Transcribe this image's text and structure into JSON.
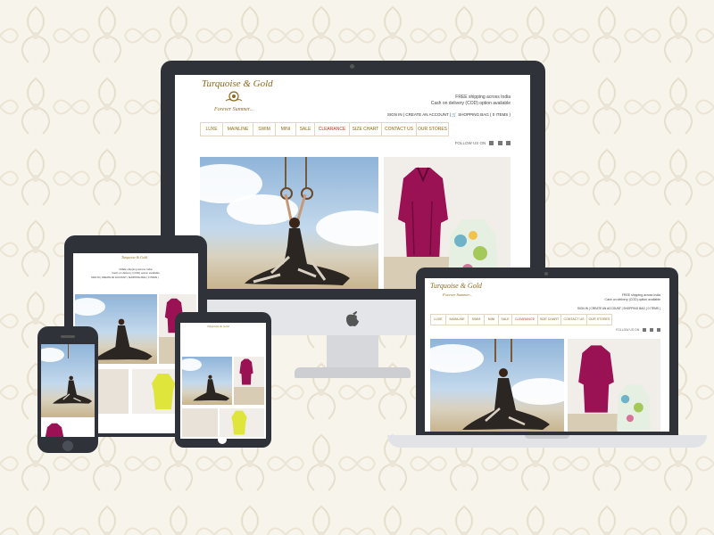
{
  "brand": {
    "name": "Turquoise & Gold",
    "tagline": "Forever Summer..."
  },
  "top_info": {
    "shipping": "FREE shipping across India",
    "cod": "Cash on delivery (COD) option available"
  },
  "account": {
    "sign_in": "SIGN IN",
    "create_account": "CREATE AN ACCOUNT",
    "bag": "SHOPPING BAG ( 0 ITEMS )"
  },
  "nav": [
    "LUXE",
    "MAINLINE",
    "SWIM",
    "MINI",
    "SALE",
    "CLEARANCE",
    "SIZE CHART",
    "CONTACT US",
    "OUR STORES"
  ],
  "follow_us": "FOLLOW US ON",
  "colors": {
    "gold": "#8a6a1f",
    "sale": "#c0392b",
    "bezel": "#2f3238",
    "background": "#f7f4ec"
  },
  "icons": [
    "facebook-icon",
    "twitter-icon",
    "youtube-icon",
    "apple-logo-icon",
    "cart-icon"
  ]
}
